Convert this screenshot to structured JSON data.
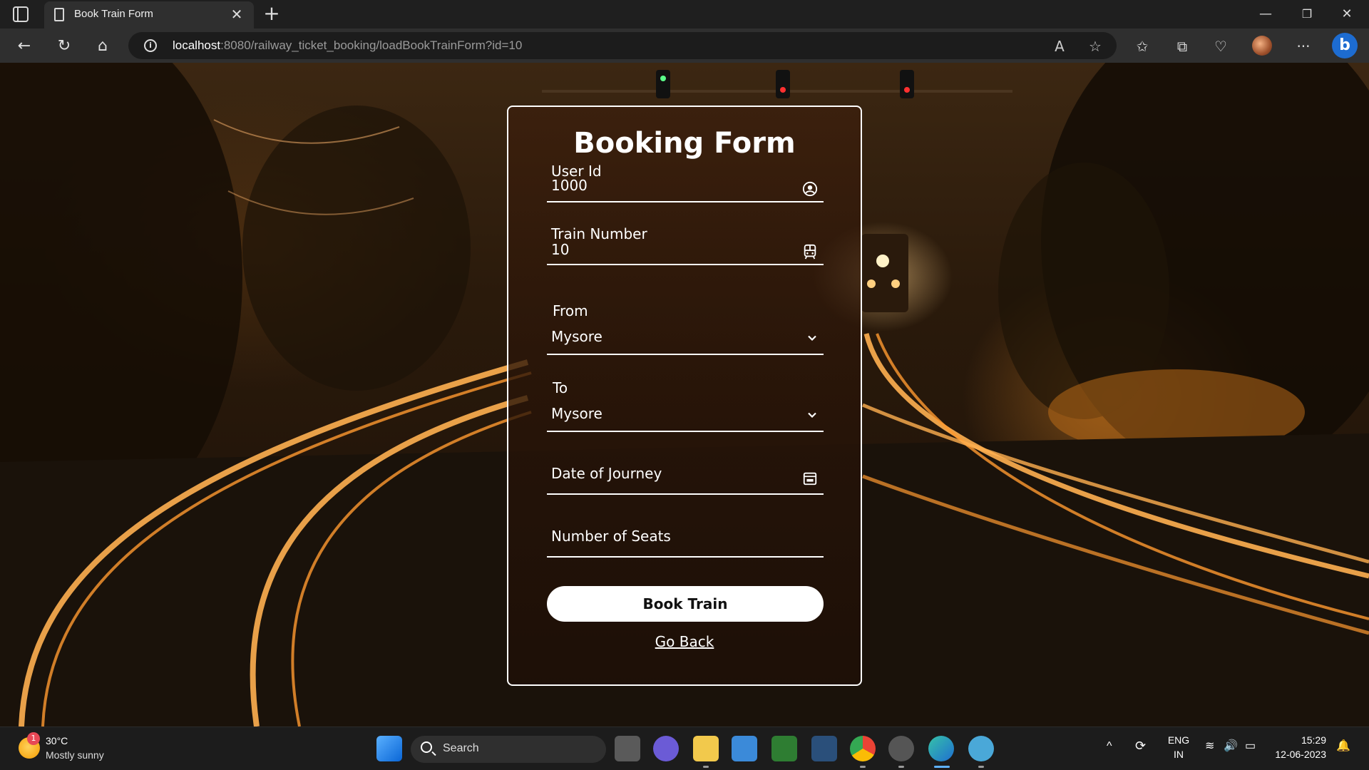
{
  "browser": {
    "tab_title": "Book Train Form",
    "url_host": "localhost",
    "url_rest": ":8080/railway_ticket_booking/loadBookTrainForm?id=10",
    "accent": "#1d6cd1"
  },
  "form": {
    "title": "Booking Form",
    "user_id_label": "User Id",
    "user_id_value": "1000",
    "train_number_label": "Train Number",
    "train_number_value": "10",
    "from_label": "From",
    "from_value": "Mysore",
    "to_label": "To",
    "to_value": "Mysore",
    "date_label": "Date of Journey",
    "seats_label": "Number of Seats",
    "submit_label": "Book Train",
    "back_label": "Go Back"
  },
  "taskbar": {
    "weather_badge": "1",
    "weather_temp": "30°C",
    "weather_desc": "Mostly sunny",
    "search_placeholder": "Search",
    "language": "ENG",
    "region": "IN",
    "time": "15:29",
    "date": "12-06-2023"
  },
  "icons": {
    "user_field": "user-circle-icon",
    "train_field": "train-icon",
    "date_field": "calendar-icon",
    "select_arrow": "chevron-down-icon"
  }
}
